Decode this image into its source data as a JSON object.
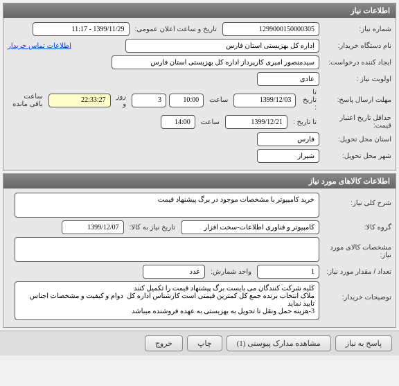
{
  "panel1": {
    "title": "اطلاعات نیاز",
    "need_number_label": "شماره نیاز:",
    "need_number": "1299000150000305",
    "announce_label": "تاریخ و ساعت اعلان عمومی:",
    "announce_value": "1399/11/29 - 11:17",
    "buyer_label": "نام دستگاه خریدار:",
    "buyer_value": "اداره کل بهزیستی استان فارس",
    "contact_link": "اطلاعات تماس خریدار",
    "creator_label": "ایجاد کننده درخواست:",
    "creator_value": "سیدمنصور امیری کارپرداز اداره کل بهزیستی استان فارس",
    "priority_label": "اولویت نیاز :",
    "priority_value": "عادی",
    "deadline_label": "مهلت ارسال پاسخ:",
    "until_label": "تا تاریخ :",
    "deadline_date": "1399/12/03",
    "time_label": "ساعت",
    "deadline_time": "10:00",
    "days_value": "3",
    "days_label": "روز و",
    "remaining_time": "22:33:27",
    "remaining_label": "ساعت باقی مانده",
    "min_credit_label": "حداقل تاریخ اعتبار قیمت:",
    "min_credit_until": "تا تاریخ :",
    "min_credit_date": "1399/12/21",
    "min_credit_time": "14:00",
    "province_label": "استان محل تحویل:",
    "province_value": "فارس",
    "city_label": "شهر محل تحویل:",
    "city_value": "شیراز"
  },
  "panel2": {
    "title": "اطلاعات کالاهای مورد نیاز",
    "desc_label": "شرح کلی نیاز:",
    "desc_value": "خرید کامپیوتر با مشخصات موجود در برگ پیشنهاد قیمت",
    "group_label": "گروه کالا:",
    "group_value": "کامپیوتر و فناوری اطلاعات-سخت افزار",
    "need_date_label": "تاریخ نیاز به کالا:",
    "need_date_value": "1399/12/07",
    "spec_label": "مشخصات کالای مورد نیاز:",
    "spec_value": "",
    "qty_label": "تعداد / مقدار مورد نیاز:",
    "qty_value": "1",
    "unit_label": "واحد شمارش:",
    "unit_value": "عدد",
    "notes_label": "توضیحات خریدار:",
    "notes_value": "کلیه شرکت کنندگان می بایست برگ پیشنهاد قیمت را تکمیل کنند\nملاک انتخاب برنده جمع کل کمترین قیمتی است کارشناس اداره کل  دوام و کیفیت و مشخصات اجناس تایید نماید\n3-هزینه حمل ونقل تا تحویل به بهزیستی به عهده فروشنده میباشد"
  },
  "buttons": {
    "reply": "پاسخ به نیاز",
    "attachments": "مشاهده مدارک پیوستی (1)",
    "print": "چاپ",
    "exit": "خروج"
  }
}
